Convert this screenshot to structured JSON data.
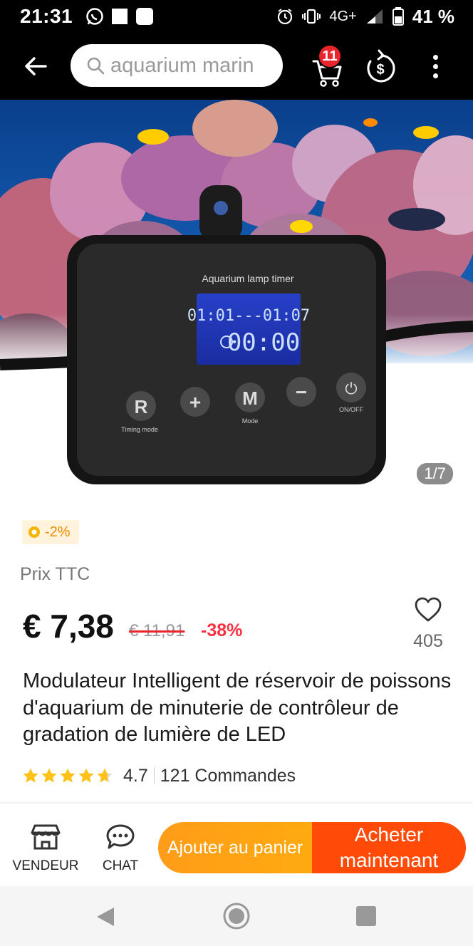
{
  "status_bar": {
    "time": "21:31",
    "network": "4G+",
    "battery": "41 %",
    "icons": [
      "whatsapp-icon",
      "square-icon",
      "square-icon",
      "alarm-icon",
      "vibrate-icon",
      "signal-icon",
      "battery-icon"
    ]
  },
  "header": {
    "search_placeholder": "aquarium marin",
    "cart_count": "11",
    "icons": [
      "back-arrow-icon",
      "search-icon",
      "cart-icon",
      "coin-dollar-icon",
      "more-vert-icon"
    ]
  },
  "gallery": {
    "counter": "1/7",
    "device_label": "Aquarium lamp timer",
    "lcd_line1": "01:01---01:07",
    "lcd_line2": "00:00",
    "buttons": [
      {
        "glyph": "R",
        "caption": "Timing mode"
      },
      {
        "glyph": "+",
        "caption": ""
      },
      {
        "glyph": "M",
        "caption": "Mode"
      },
      {
        "glyph": "−",
        "caption": ""
      },
      {
        "glyph": "⏻",
        "caption": "ON/OFF"
      }
    ]
  },
  "product": {
    "coin_discount": "-2%",
    "price_label": "Prix TTC",
    "price": "€ 7,38",
    "original_price": "€ 11,91",
    "discount_percent": "-38%",
    "wishlist_count": "405",
    "title": "Modulateur Intelligent de réservoir de poissons d'aquarium de minuterie de contrôleur de gradation de lumière de LED",
    "rating": "4.7",
    "rating_stars": 4.7,
    "orders": "121 Commandes"
  },
  "actions": {
    "store_label": "VENDEUR",
    "chat_label": "CHAT",
    "add_to_cart_label": "Ajouter au panier",
    "buy_now_label": "Acheter maintenant"
  },
  "colors": {
    "accent_orange": "#ff9c18",
    "accent_red": "#ff4a08",
    "discount_red": "#ff3040",
    "badge_red": "#e8242c",
    "star_yellow": "#ffc21a"
  }
}
